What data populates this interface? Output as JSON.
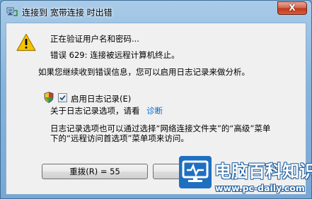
{
  "window": {
    "title": "连接到 宽带连接 时出错",
    "close_label": "X"
  },
  "messages": {
    "verifying": "正在验证用户名和密码...",
    "error": "错误 629: 连接被远程计算机终止。",
    "advice": "如果您继续收到错误信息，您可以启用日志记录来做分析。"
  },
  "logging": {
    "checkbox_checked": true,
    "label": "启用日志记录(E)",
    "about_text": "关于日志记录选项，请看",
    "diagnose_link": "诊断"
  },
  "note": {
    "line1": "日志记录选项也可以通过选择“网络连接文件夹”的“高级”菜单",
    "line2": "下的“远程访问首选项”菜单项来访问。"
  },
  "buttons": {
    "redial_label": "重拨(R) = 55"
  },
  "watermark": {
    "title": "电脑百科知识",
    "url": "www.pc-daily.com"
  },
  "colors": {
    "title_gradient_top": "#a9cbe8",
    "client_bg": "#f0f0f0",
    "link": "#0066cc",
    "close_red": "#c0381c",
    "watermark_blue": "#1f6fc0"
  }
}
